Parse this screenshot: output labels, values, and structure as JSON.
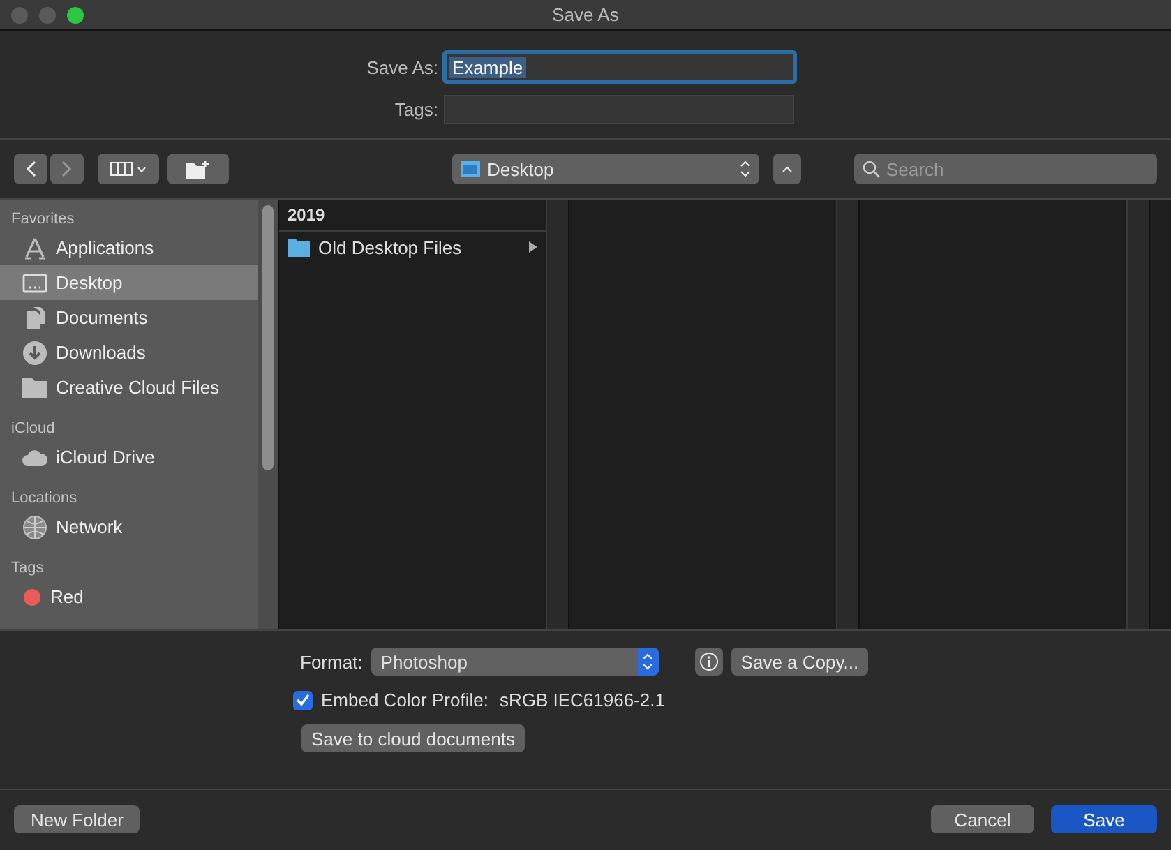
{
  "window": {
    "title": "Save As"
  },
  "save_as": {
    "label": "Save As:",
    "value": "Example"
  },
  "tags": {
    "label": "Tags:"
  },
  "toolbar": {
    "location": "Desktop",
    "search_placeholder": "Search"
  },
  "sidebar": {
    "sections": [
      {
        "title": "Favorites",
        "items": [
          {
            "label": "Applications",
            "kind": "apps",
            "selected": false
          },
          {
            "label": "Desktop",
            "kind": "desktop",
            "selected": true
          },
          {
            "label": "Documents",
            "kind": "documents",
            "selected": false
          },
          {
            "label": "Downloads",
            "kind": "downloads",
            "selected": false
          },
          {
            "label": "Creative Cloud Files",
            "kind": "folder",
            "selected": false
          }
        ]
      },
      {
        "title": "iCloud",
        "items": [
          {
            "label": "iCloud Drive",
            "kind": "cloud",
            "selected": false
          }
        ]
      },
      {
        "title": "Locations",
        "items": [
          {
            "label": "Network",
            "kind": "network",
            "selected": false
          }
        ]
      },
      {
        "title": "Tags",
        "items": [
          {
            "label": "Red",
            "kind": "tag",
            "color": "#ec5b56",
            "selected": false
          }
        ]
      }
    ]
  },
  "browser": {
    "column_1": {
      "header": "2019",
      "items": [
        {
          "label": "Old Desktop Files",
          "kind": "folder"
        }
      ]
    }
  },
  "options": {
    "format_label": "Format:",
    "format_value": "Photoshop",
    "save_copy": "Save a Copy...",
    "embed": {
      "label": "Embed Color Profile:",
      "value": "sRGB IEC61966-2.1",
      "checked": true
    },
    "cloud_button": "Save to cloud documents"
  },
  "footer": {
    "new_folder": "New Folder",
    "cancel": "Cancel",
    "save": "Save"
  }
}
